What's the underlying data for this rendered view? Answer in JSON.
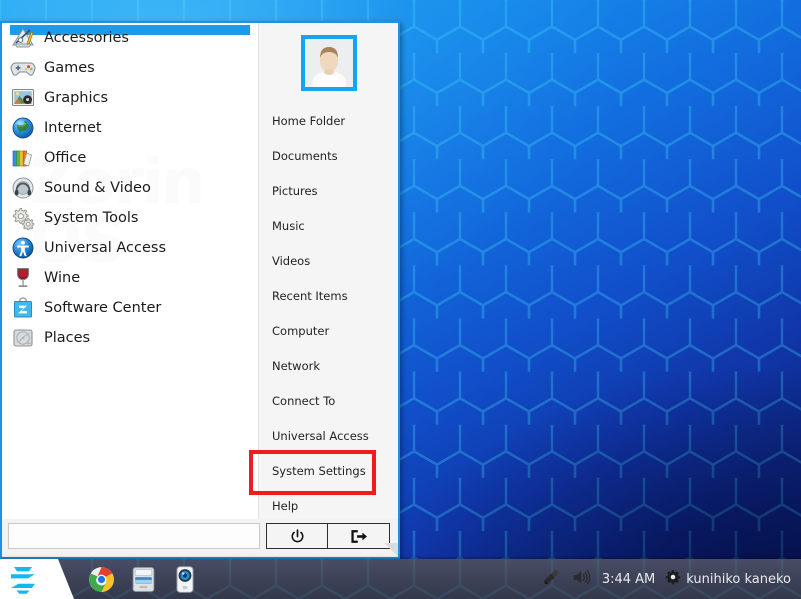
{
  "desktop": {
    "wallpaper_name": "zorin-hexagon-blue",
    "wallpaper_colors": {
      "light": "#21a8f5",
      "mid": "#0b68dd",
      "dark": "#03155e"
    }
  },
  "menu": {
    "accent_color": "#1e91e0",
    "highlight_color": "#1e9ae6",
    "watermark_text": "Zorin OS",
    "categories": [
      {
        "label": "Accessories",
        "icon": "accessories-icon",
        "selected": true
      },
      {
        "label": "Games",
        "icon": "gamepad-icon",
        "selected": false
      },
      {
        "label": "Graphics",
        "icon": "graphics-icon",
        "selected": false
      },
      {
        "label": "Internet",
        "icon": "globe-icon",
        "selected": false
      },
      {
        "label": "Office",
        "icon": "office-books-icon",
        "selected": false
      },
      {
        "label": "Sound & Video",
        "icon": "headphones-icon",
        "selected": false
      },
      {
        "label": "System Tools",
        "icon": "gears-icon",
        "selected": false
      },
      {
        "label": "Universal Access",
        "icon": "accessibility-icon",
        "selected": false
      },
      {
        "label": "Wine",
        "icon": "wine-glass-icon",
        "selected": false
      },
      {
        "label": "Software Center",
        "icon": "software-center-icon",
        "selected": false
      },
      {
        "label": "Places",
        "icon": "hard-drive-icon",
        "selected": false
      }
    ],
    "avatar": {
      "alt": "user-avatar",
      "border_color": "#13a5f0"
    },
    "places": [
      {
        "label": "Home Folder",
        "highlighted": false
      },
      {
        "label": "Documents",
        "highlighted": false
      },
      {
        "label": "Pictures",
        "highlighted": false
      },
      {
        "label": "Music",
        "highlighted": false
      },
      {
        "label": "Videos",
        "highlighted": false
      },
      {
        "label": "Recent Items",
        "highlighted": false
      },
      {
        "label": "Computer",
        "highlighted": false
      },
      {
        "label": "Network",
        "highlighted": false
      },
      {
        "label": "Connect To",
        "highlighted": false
      },
      {
        "label": "Universal Access",
        "highlighted": false
      },
      {
        "label": "System Settings",
        "highlighted": true
      },
      {
        "label": "Help",
        "highlighted": false
      }
    ],
    "highlight_box_color": "#ee1c1c",
    "search": {
      "value": "",
      "placeholder": ""
    },
    "footer_buttons": [
      {
        "label": "",
        "icon": "power-icon",
        "name": "shutdown-button"
      },
      {
        "label": "",
        "icon": "logout-icon",
        "name": "logout-button"
      }
    ]
  },
  "taskbar": {
    "start_button": {
      "icon": "zorin-logo-icon",
      "label": ""
    },
    "launchers": [
      {
        "icon": "chrome-icon",
        "label": ""
      },
      {
        "icon": "file-manager-icon",
        "label": ""
      },
      {
        "icon": "camera-icon",
        "label": ""
      }
    ],
    "tray": {
      "icons": [
        {
          "icon": "microphone-icon"
        },
        {
          "icon": "volume-icon"
        }
      ],
      "clock": "3:44 AM",
      "user_icon": "gear-icon",
      "user_name": "kunihiko kaneko"
    }
  }
}
